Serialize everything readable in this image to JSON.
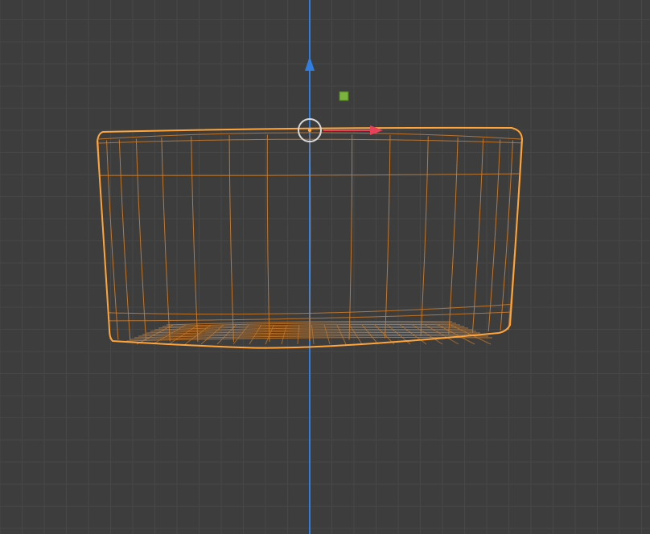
{
  "viewport": {
    "background": "#3d3d3d",
    "grid_minor_color": "#474747",
    "grid_major_color": "#4f4f4f"
  },
  "axes": {
    "z_axis_color": "#2f7ee0",
    "x_axis_color": "#e8415a"
  },
  "selection": {
    "wire_color": "#f0922e",
    "wire_inner_color": "#c97a2a",
    "outline_color": "#ffa53a"
  },
  "gizmo": {
    "pivot_ring_color": "#d9d9d9",
    "plane_handle_color": "#7ab33d",
    "plane_handle_border": "#4d7a1f",
    "icons": [
      "translate-z-arrow-icon",
      "translate-x-arrow-icon",
      "pivot-ring-icon",
      "plane-handle-icon"
    ]
  }
}
